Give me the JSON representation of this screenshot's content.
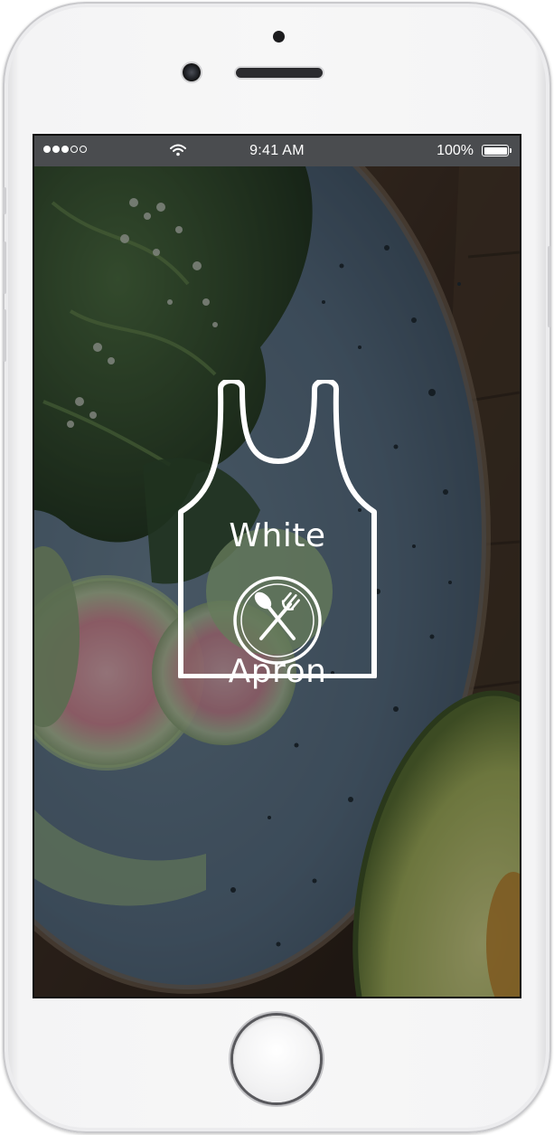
{
  "status_bar": {
    "signal_bars_filled": 3,
    "signal_bars_total": 5,
    "time": "9:41 AM",
    "battery_percent": "100%"
  },
  "brand": {
    "name_line1": "White",
    "name_line2": "Apron",
    "logo_icon": "apron-icon",
    "emblem_icon": "spoon-fork-icon"
  },
  "colors": {
    "status_bar_bg": "#4a4c4f",
    "logo_stroke": "#ffffff",
    "plate_blue": "#5b7287"
  }
}
